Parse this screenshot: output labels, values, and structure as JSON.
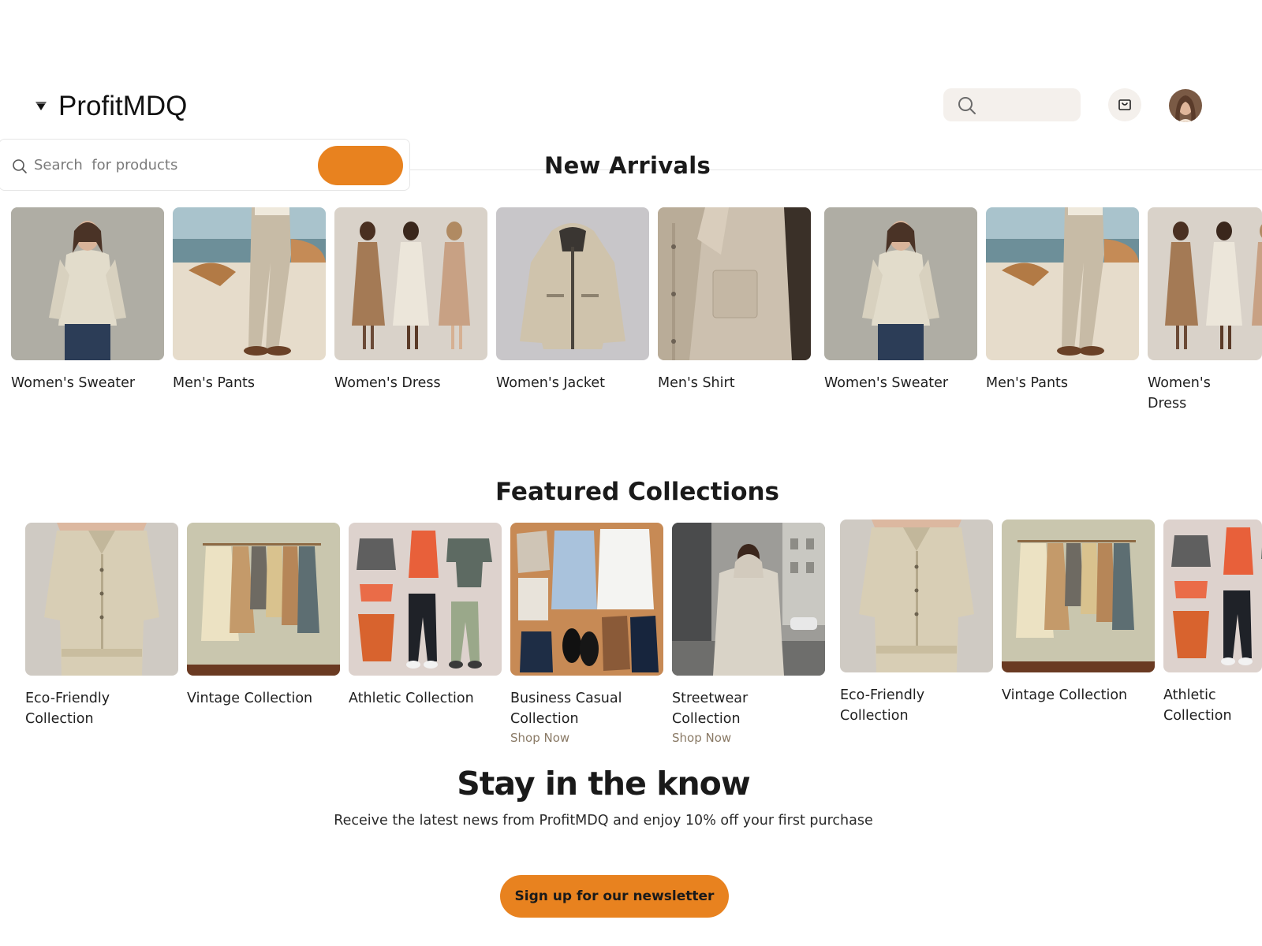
{
  "header": {
    "brand": "ProfitMDQ",
    "search_icon": "search-icon",
    "cart_icon": "shopping-bag-icon",
    "avatar": "user-avatar"
  },
  "search": {
    "placeholder": "Search  for products",
    "value": "",
    "submit_label": ""
  },
  "new_arrivals": {
    "title": "New Arrivals",
    "products": [
      {
        "name": "Women's Sweater"
      },
      {
        "name": "Men's Pants"
      },
      {
        "name": "Women's Dress"
      },
      {
        "name": "Women's Jacket"
      },
      {
        "name": "Men's Shirt"
      },
      {
        "name": "Women's Sweater"
      },
      {
        "name": "Men's Pants"
      },
      {
        "name": "Women's Dress"
      }
    ]
  },
  "featured": {
    "title": "Featured Collections",
    "collections": [
      {
        "name": "Eco-Friendly Collection",
        "cta": ""
      },
      {
        "name": "Vintage Collection",
        "cta": ""
      },
      {
        "name": "Athletic Collection",
        "cta": ""
      },
      {
        "name": "Business Casual Collection",
        "cta": "Shop Now"
      },
      {
        "name": "Streetwear Collection",
        "cta": "Shop Now"
      },
      {
        "name": "Eco-Friendly Collection",
        "cta": ""
      },
      {
        "name": "Vintage Collection",
        "cta": ""
      },
      {
        "name": "Athletic Collection",
        "cta": ""
      }
    ]
  },
  "newsletter": {
    "title": "Stay in the know",
    "subtitle": "Receive the latest news from ProfitMDQ and enjoy 10% off your first purchase",
    "button_label": "Sign up for our newsletter"
  },
  "colors": {
    "accent": "#e8821f",
    "surface": "#f4f0ec",
    "muted_link": "#8a7a66"
  }
}
